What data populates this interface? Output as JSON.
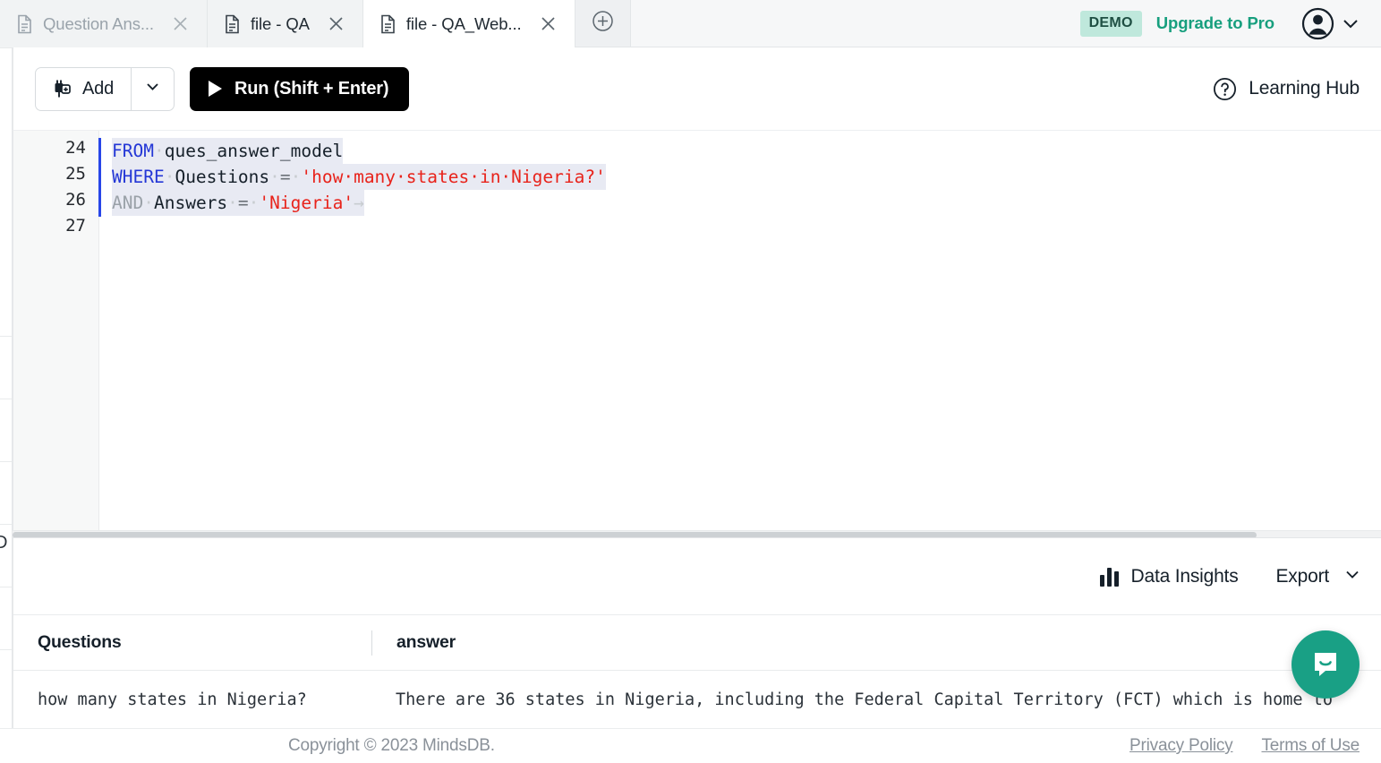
{
  "tabs": [
    {
      "label": "Question Ans...",
      "icon": "document-icon",
      "active": false,
      "dim": true
    },
    {
      "label": "file - QA",
      "icon": "document-icon",
      "active": false,
      "dim": false
    },
    {
      "label": "file - QA_Web...",
      "icon": "document-icon",
      "active": true,
      "dim": false
    }
  ],
  "tabbar": {
    "new_tab_icon": "plus-circle-icon",
    "close_icon": "close-icon",
    "demo_badge": "DEMO",
    "upgrade_label": "Upgrade to Pro",
    "account_icon": "user-avatar-icon",
    "account_caret_icon": "chevron-down-icon"
  },
  "toolbar": {
    "add_label": "Add",
    "add_icon": "database-plug-plus-icon",
    "add_caret_icon": "chevron-down-icon",
    "run_label": "Run (Shift + Enter)",
    "run_icon": "play-icon",
    "learning_hub_label": "Learning Hub",
    "learning_hub_icon": "question-circle-icon"
  },
  "editor": {
    "line_numbers": [
      "24",
      "25",
      "26",
      "27"
    ],
    "lines": [
      {
        "number": "24",
        "selected": true,
        "tokens": [
          {
            "t": "FROM",
            "k": "kw"
          },
          {
            "t": "·",
            "k": "dot"
          },
          {
            "t": "ques_answer_model",
            "k": "plain"
          }
        ]
      },
      {
        "number": "25",
        "selected": true,
        "tokens": [
          {
            "t": "WHERE",
            "k": "kw"
          },
          {
            "t": "·",
            "k": "dot"
          },
          {
            "t": "Questions",
            "k": "plain"
          },
          {
            "t": "·",
            "k": "dot"
          },
          {
            "t": "=",
            "k": "op"
          },
          {
            "t": "·",
            "k": "dot"
          },
          {
            "t": "'how·many·states·in·Nigeria?'",
            "k": "str"
          }
        ]
      },
      {
        "number": "26",
        "selected": true,
        "tokens": [
          {
            "t": "AND",
            "k": "kw-dim"
          },
          {
            "t": "·",
            "k": "dot"
          },
          {
            "t": "Answers",
            "k": "plain"
          },
          {
            "t": "·",
            "k": "dot"
          },
          {
            "t": "=",
            "k": "op"
          },
          {
            "t": "·",
            "k": "dot"
          },
          {
            "t": "'Nigeria'",
            "k": "str"
          },
          {
            "t": "→",
            "k": "crlf"
          }
        ]
      },
      {
        "number": "27",
        "selected": false,
        "tokens": []
      }
    ],
    "selection_marker_color": "#2846e8",
    "selection_bg": "#e8eaf3",
    "keyword_color": "#2437d6",
    "string_color": "#e8231b"
  },
  "results": {
    "data_insights_label": "Data Insights",
    "data_insights_icon": "bar-chart-icon",
    "export_label": "Export",
    "export_caret_icon": "chevron-down-icon",
    "columns": [
      "Questions",
      "answer"
    ],
    "rows": [
      {
        "Questions": "how many states in Nigeria?",
        "answer": "There are 36 states in Nigeria, including the Federal Capital Territory (FCT) which is home to"
      }
    ]
  },
  "footer": {
    "copyright": "Copyright © 2023 MindsDB.",
    "privacy_label": "Privacy Policy",
    "terms_label": "Terms of Use"
  },
  "chat": {
    "icon": "chat-bubble-smile-icon",
    "color": "#19a085"
  },
  "colors": {
    "accent_green": "#179f7e",
    "badge_bg": "#bfe8dc",
    "run_button_bg": "#000000",
    "tabbar_bg": "#f6f7f8"
  }
}
